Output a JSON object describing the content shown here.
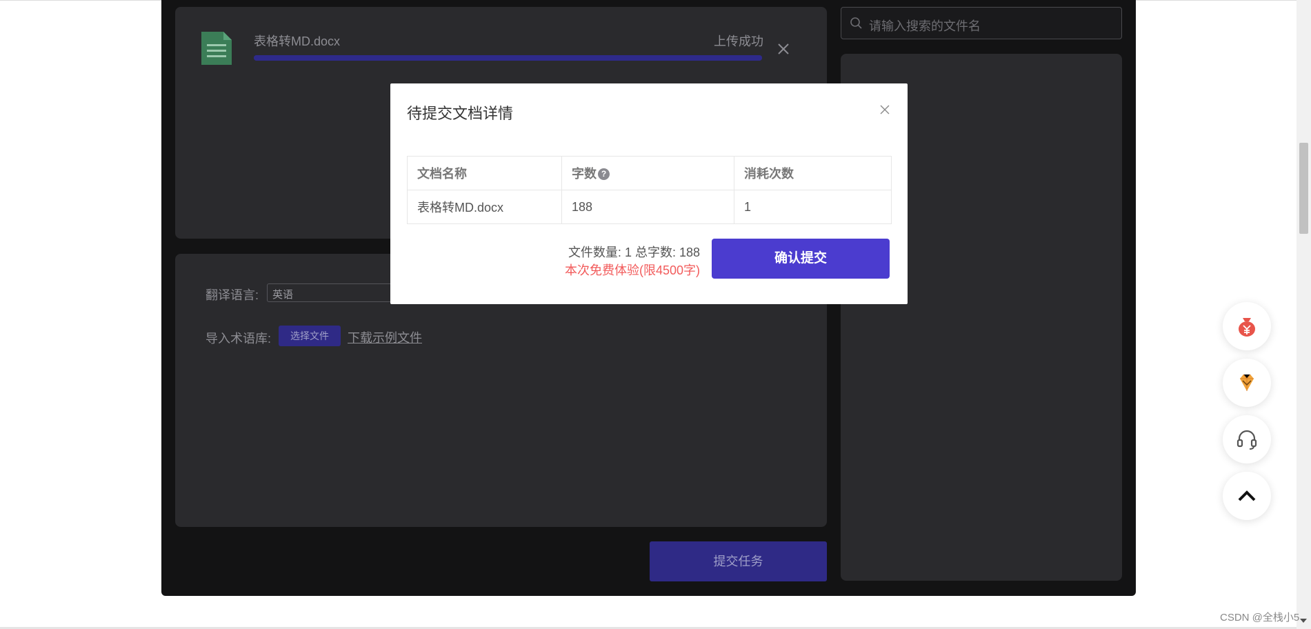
{
  "upload": {
    "file_name": "表格转MD.docx",
    "status": "上传成功",
    "progress": 1.0,
    "file_icon": "document-icon",
    "close_icon": "close-icon"
  },
  "settings": {
    "language_label": "翻译语言:",
    "language_value": "英语",
    "term_label": "导入术语库:",
    "choose_file": "选择文件",
    "download_example": "下载示例文件"
  },
  "submit_task": "提交任务",
  "search": {
    "placeholder": "请输入搜索的文件名",
    "icon": "search-icon"
  },
  "modal": {
    "title": "待提交文档详情",
    "columns": [
      "文档名称",
      "字数",
      "消耗次数"
    ],
    "rows": [
      [
        "表格转MD.docx",
        "188",
        "1"
      ]
    ],
    "summary": "文件数量: 1 总字数: 188",
    "free_note": "本次免费体验(限4500字)",
    "confirm": "确认提交",
    "help_icon": "question-icon"
  },
  "floating": [
    "money-bag-icon",
    "diamond-icon",
    "headset-icon",
    "chevron-up-icon"
  ],
  "watermark": "CSDN @全栈小5",
  "colors": {
    "accent": "#4b3ccf",
    "dim_accent": "#2f2a86",
    "warning": "#f25b5b",
    "panel": "#2a2a2d",
    "app_bg": "#131314"
  }
}
